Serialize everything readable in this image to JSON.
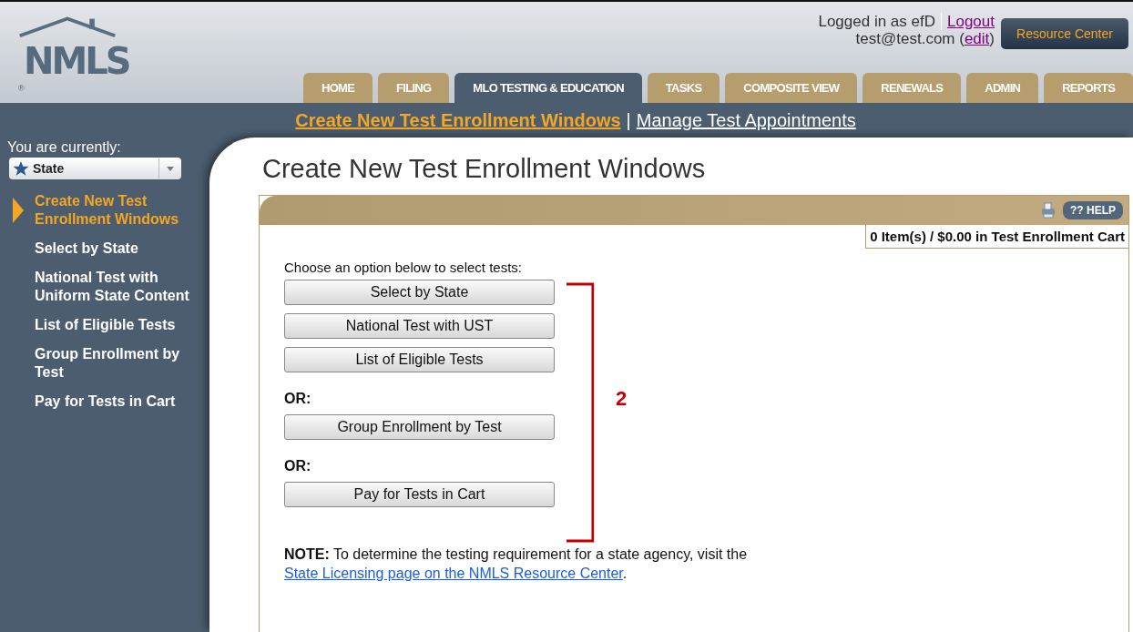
{
  "logo": {
    "text": "NMLS",
    "mark": "®"
  },
  "user": {
    "logged_in": "Logged in as efD",
    "logout": "Logout",
    "email": "test@test.com",
    "open_paren": "(",
    "edit": "edit",
    "close_paren": ")"
  },
  "resource_button": "Resource Center",
  "tabs": [
    {
      "label": "HOME",
      "selected": false
    },
    {
      "label": "FILING",
      "selected": false
    },
    {
      "label": "MLO TESTING & EDUCATION",
      "selected": true
    },
    {
      "label": "TASKS",
      "selected": false
    },
    {
      "label": "COMPOSITE VIEW",
      "selected": false
    },
    {
      "label": "RENEWALS",
      "selected": false
    },
    {
      "label": "ADMIN",
      "selected": false
    },
    {
      "label": "REPORTS",
      "selected": false
    }
  ],
  "subnav": [
    {
      "label": "Create New Test Enrollment Windows",
      "selected": true
    },
    {
      "label": "Manage Test Appointments",
      "selected": false
    }
  ],
  "subnav_separator": "|",
  "sidebar": {
    "caption": "You are currently:",
    "role": "State",
    "items": [
      {
        "label": "Create New Test Enrollment Windows",
        "selected": true
      },
      {
        "label": "Select by State",
        "selected": false
      },
      {
        "label": "National Test with Uniform State Content",
        "selected": false
      },
      {
        "label": "List of Eligible Tests",
        "selected": false
      },
      {
        "label": "Group Enrollment by Test",
        "selected": false
      },
      {
        "label": "Pay for Tests in Cart",
        "selected": false
      }
    ]
  },
  "page_title": "Create New Test Enrollment Windows",
  "help": {
    "glyph": "??",
    "label": "HELP"
  },
  "cart": "0 Item(s) / $0.00 in Test Enrollment Cart",
  "intro": "Choose an option below to select tests:",
  "options": [
    {
      "kind": "button",
      "label": "Select by State"
    },
    {
      "kind": "button",
      "label": "National Test with UST"
    },
    {
      "kind": "button",
      "label": "List of Eligible Tests"
    },
    {
      "kind": "separator",
      "label": "OR:"
    },
    {
      "kind": "button",
      "label": "Group Enrollment by Test"
    },
    {
      "kind": "separator",
      "label": "OR:"
    },
    {
      "kind": "button",
      "label": "Pay for Tests in Cart"
    }
  ],
  "annotation": "2",
  "note": {
    "text": "**NOTE:** To determine the testing requirement for a state agency, visit the",
    "link": "State Licensing page on the NMLS Resource Center",
    "end": "."
  }
}
